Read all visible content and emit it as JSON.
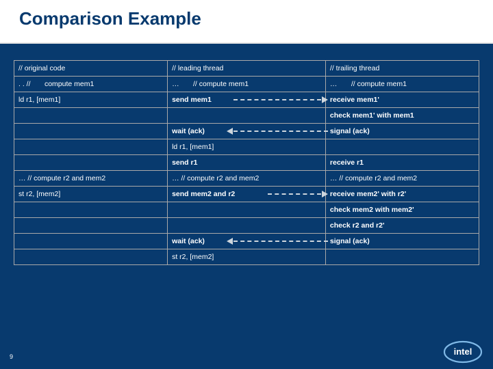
{
  "title": "Comparison Example",
  "pagenum": "9",
  "logo_name": "intel-logo",
  "col1": {
    "r0": "// original code",
    "r1a": ". .  //",
    "r1b": "compute mem1",
    "r2": "ld r1, [mem1]",
    "r3": "",
    "r4": "",
    "r5": "",
    "r6": "",
    "r7": "  … // compute r2 and mem2",
    "r8": "st r2, [mem2]",
    "r9": "",
    "r10": "",
    "r11": "",
    "r12": ""
  },
  "col2": {
    "r0": "// leading thread",
    "r1a": "…",
    "r1b": "// compute mem1",
    "r2": "send mem1",
    "r3": "",
    "r4": "wait (ack)",
    "r5": "ld r1, [mem1]",
    "r6": "send r1",
    "r7": "… // compute r2 and mem2",
    "r8": "send mem2 and r2",
    "r9": "",
    "r10": "",
    "r11": "wait (ack)",
    "r12": "st r2, [mem2]"
  },
  "col3": {
    "r0": "// trailing thread",
    "r1a": "…",
    "r1b": "// compute mem1",
    "r2": "receive mem1'",
    "r3": "check mem1' with mem1",
    "r4": "signal (ack)",
    "r5": "",
    "r6": "receive r1",
    "r7": "… // compute r2 and mem2",
    "r8": "receive mem2' with r2'",
    "r9": "check mem2 with mem2'",
    "r10": "check r2 and r2'",
    "r11": "signal (ack)",
    "r12": ""
  }
}
